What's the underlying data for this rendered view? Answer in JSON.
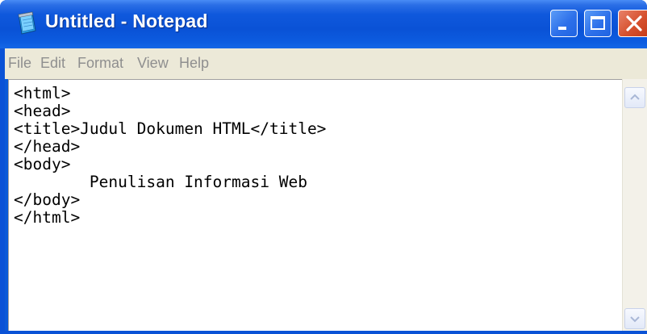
{
  "window": {
    "title": "Untitled - Notepad",
    "icon": "notepad-icon",
    "controls": [
      "minimize-icon",
      "maximize-icon",
      "close-icon"
    ]
  },
  "menu": {
    "items": [
      {
        "label": "File"
      },
      {
        "label": "Edit"
      },
      {
        "label": "Format"
      },
      {
        "label": "View"
      },
      {
        "label": "Help"
      }
    ]
  },
  "editor": {
    "lines": [
      "<html>",
      "<head>",
      "<title>Judul Dokumen HTML</title>",
      "</head>",
      "<body>",
      "        Penulisan Informasi Web",
      "</body>",
      "</html>"
    ]
  },
  "colors": {
    "titlebar": "#0a52d6",
    "close_button": "#d6502d",
    "menubar": "#ece9d8",
    "menu_text_disabled": "#8f8f8f"
  }
}
